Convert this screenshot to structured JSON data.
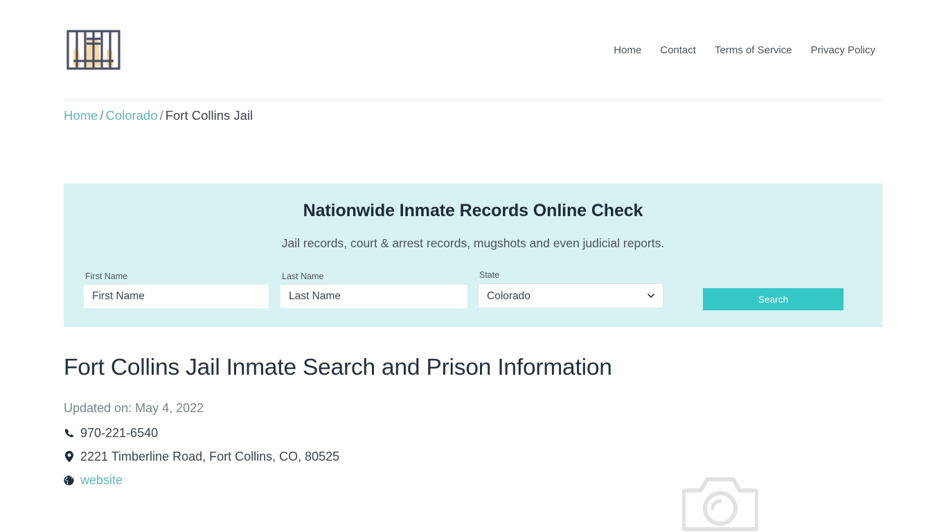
{
  "header": {
    "logo_name": "jail-bars-logo",
    "nav": [
      {
        "label": "Home"
      },
      {
        "label": "Contact"
      },
      {
        "label": "Terms of Service"
      },
      {
        "label": "Privacy Policy"
      }
    ]
  },
  "breadcrumb": {
    "home": "Home",
    "sep1": "/",
    "state": "Colorado",
    "sep2": "/",
    "current": "Fort Collins Jail"
  },
  "search_panel": {
    "title": "Nationwide Inmate Records Online Check",
    "subtitle": "Jail records, court & arrest records, mugshots and even judicial reports.",
    "first_name": {
      "label": "First Name",
      "placeholder": "First Name",
      "value": ""
    },
    "last_name": {
      "label": "Last Name",
      "placeholder": "Last Name",
      "value": ""
    },
    "state": {
      "label": "State",
      "selected": "Colorado",
      "options": [
        "Colorado"
      ]
    },
    "search_button": "Search",
    "accent_color": "#35c6c6",
    "panel_color": "#d7f2f2"
  },
  "article": {
    "title": "Fort Collins Jail Inmate Search and Prison Information",
    "updated": "Updated on: May 4, 2022",
    "contacts": [
      {
        "icon": "phone-icon",
        "text": "970-221-6540",
        "is_link": false
      },
      {
        "icon": "map-marker-icon",
        "text": "2221 Timberline Road, Fort Collins, CO, 80525",
        "is_link": false
      },
      {
        "icon": "globe-icon",
        "text": "website",
        "is_link": true
      }
    ],
    "placeholder_image": "camera-placeholder-icon"
  }
}
